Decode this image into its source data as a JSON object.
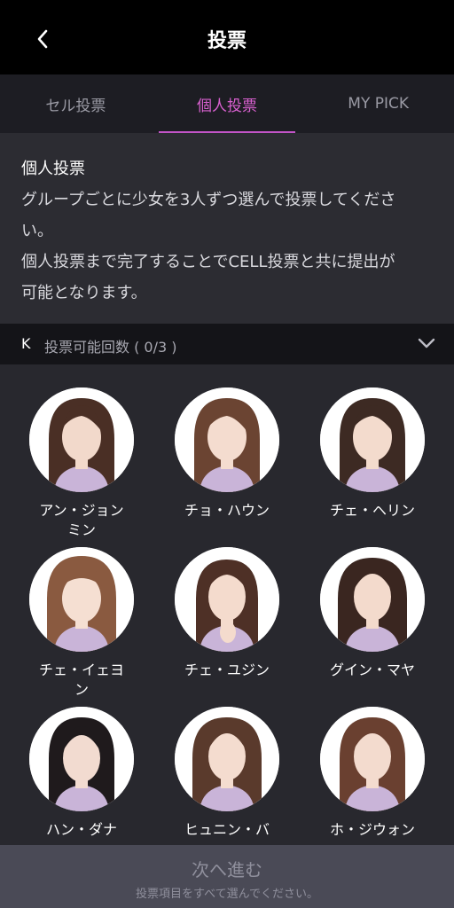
{
  "header": {
    "title": "投票"
  },
  "tabs": [
    {
      "label": "セル投票",
      "active": false
    },
    {
      "label": "個人投票",
      "active": true
    },
    {
      "label": "MY PICK",
      "active": false
    }
  ],
  "info": {
    "heading": "個人投票",
    "body": "グループごとに少女を3人ずつ選んで投票してくださ\nい。\n個人投票まで完了することでCELL投票と共に提出が\n可能となります。"
  },
  "group": {
    "letter": "K",
    "count_label": "投票可能回数 ( 0/3 )"
  },
  "candidates": [
    {
      "name": "アン・ジョン\nミン"
    },
    {
      "name": "チョ・ハウン"
    },
    {
      "name": "チェ・ヘリン"
    },
    {
      "name": "チェ・イェヨ\nン"
    },
    {
      "name": "チェ・ユジン"
    },
    {
      "name": "グイン・マヤ"
    },
    {
      "name": "ハン・ダナ"
    },
    {
      "name": "ヒュニン・バ"
    },
    {
      "name": "ホ・ジウォン"
    }
  ],
  "footer": {
    "next_label": "次へ進む",
    "note": "投票項目をすべて選んでください。"
  },
  "colors": {
    "accent": "#c254c7",
    "header_bg": "#000000",
    "footer_bg": "#4a4a56"
  },
  "icons": {
    "back": "chevron-left-icon",
    "expand": "chevron-down-icon"
  }
}
